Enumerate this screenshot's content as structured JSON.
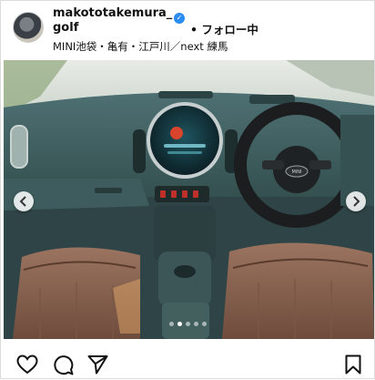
{
  "post": {
    "username": "makototakemura_golf",
    "verified_icon": "verified-badge-icon",
    "separator": "•",
    "follow_label": "フォロー中",
    "location": "MINI池袋・亀有・江戸川／next 練馬"
  },
  "carousel": {
    "prev_icon": "chevron-left-icon",
    "next_icon": "chevron-right-icon",
    "slide_count": 5,
    "active_index": 1
  },
  "photo": {
    "subject": "MINI Countryman interior – dashboard, round OLED center display, steering wheel, brown leather seats",
    "steering_logo": "MINI"
  },
  "actions": {
    "like_icon": "heart-icon",
    "comment_icon": "comment-icon",
    "share_icon": "send-icon",
    "save_icon": "bookmark-icon"
  },
  "colors": {
    "verified": "#2b8cf0",
    "dashboard": "#3d5a5e",
    "seat_leather": "#8a6450"
  }
}
